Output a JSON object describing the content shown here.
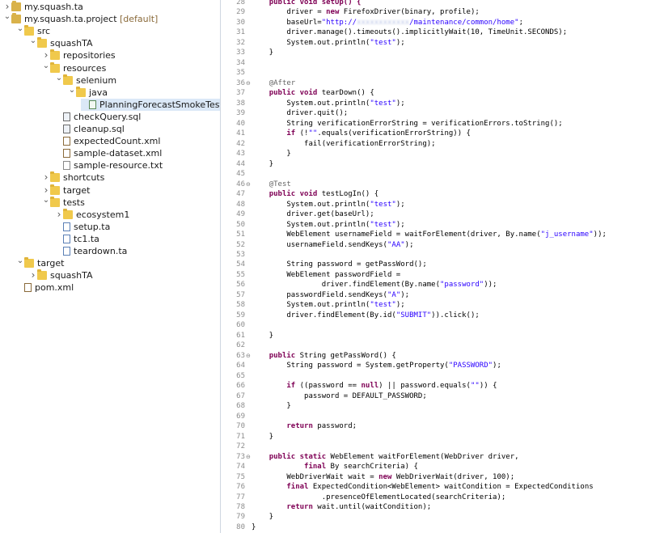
{
  "tree": [
    {
      "label": "my.squash.ta",
      "icon": "project-icon",
      "depth": 0,
      "toggle": "closed"
    },
    {
      "label": "my.squash.ta.project",
      "decoration": " [default]",
      "icon": "project-icon",
      "depth": 0,
      "toggle": "open"
    },
    {
      "label": "src",
      "icon": "folder-icon",
      "depth": 1,
      "toggle": "open"
    },
    {
      "label": "squashTA",
      "icon": "folder-icon",
      "depth": 2,
      "toggle": "open"
    },
    {
      "label": "repositories",
      "icon": "folder-icon",
      "depth": 3,
      "toggle": "closed"
    },
    {
      "label": "resources",
      "icon": "folder-icon",
      "depth": 3,
      "toggle": "open"
    },
    {
      "label": "selenium",
      "icon": "folder-icon",
      "depth": 4,
      "toggle": "open"
    },
    {
      "label": "java",
      "icon": "folder-icon",
      "depth": 5,
      "toggle": "open"
    },
    {
      "label": "PlanningForecastSmokeTest.jav",
      "icon": "java-file-icon",
      "depth": 6,
      "toggle": "",
      "selected": true
    },
    {
      "label": "checkQuery.sql",
      "icon": "sql-file-icon",
      "depth": 4,
      "toggle": ""
    },
    {
      "label": "cleanup.sql",
      "icon": "sql-file-icon",
      "depth": 4,
      "toggle": ""
    },
    {
      "label": "expectedCount.xml",
      "icon": "xml-file-icon",
      "depth": 4,
      "toggle": ""
    },
    {
      "label": "sample-dataset.xml",
      "icon": "xml-file-icon",
      "depth": 4,
      "toggle": ""
    },
    {
      "label": "sample-resource.txt",
      "icon": "txt-file-icon",
      "depth": 4,
      "toggle": ""
    },
    {
      "label": "shortcuts",
      "icon": "folder-icon",
      "depth": 3,
      "toggle": "closed"
    },
    {
      "label": "target",
      "icon": "folder-icon",
      "depth": 3,
      "toggle": "closed"
    },
    {
      "label": "tests",
      "icon": "folder-icon",
      "depth": 3,
      "toggle": "open"
    },
    {
      "label": "ecosystem1",
      "icon": "folder-icon",
      "depth": 4,
      "toggle": "closed"
    },
    {
      "label": "setup.ta",
      "icon": "ta-file-icon",
      "depth": 4,
      "toggle": ""
    },
    {
      "label": "tc1.ta",
      "icon": "ta-file-icon",
      "depth": 4,
      "toggle": ""
    },
    {
      "label": "teardown.ta",
      "icon": "ta-file-icon",
      "depth": 4,
      "toggle": ""
    },
    {
      "label": "target",
      "icon": "folder-icon",
      "depth": 1,
      "toggle": "open"
    },
    {
      "label": "squashTA",
      "icon": "folder-icon",
      "depth": 2,
      "toggle": "closed"
    },
    {
      "label": "pom.xml",
      "icon": "xml-file-icon",
      "depth": 1,
      "toggle": ""
    }
  ],
  "editor": {
    "lines": [
      {
        "n": "28",
        "segs": [
          [
            "    ",
            ""
          ],
          [
            "public void setUp() {",
            "kw-partial"
          ]
        ]
      },
      {
        "n": "29",
        "segs": [
          [
            "        driver = ",
            ""
          ],
          [
            "new",
            "kw"
          ],
          [
            " FirefoxDriver(binary, profile);",
            ""
          ]
        ]
      },
      {
        "n": "30",
        "segs": [
          [
            "        baseUrl=",
            ""
          ],
          [
            "\"http://",
            "str"
          ],
          [
            "xxxxxxxxxxxx",
            "blur"
          ],
          [
            "/maintenance/common/home\"",
            "str"
          ],
          [
            ";",
            ""
          ]
        ]
      },
      {
        "n": "31",
        "segs": [
          [
            "        driver.manage().timeouts().implicitlyWait(10, TimeUnit.SECONDS);",
            ""
          ]
        ]
      },
      {
        "n": "32",
        "segs": [
          [
            "        System.out.println(",
            ""
          ],
          [
            "\"test\"",
            "str"
          ],
          [
            ");",
            ""
          ]
        ]
      },
      {
        "n": "33",
        "segs": [
          [
            "    }",
            ""
          ]
        ]
      },
      {
        "n": "34",
        "segs": []
      },
      {
        "n": "35",
        "segs": []
      },
      {
        "n": "36",
        "fold": true,
        "segs": [
          [
            "    ",
            ""
          ],
          [
            "@After",
            "ann"
          ]
        ]
      },
      {
        "n": "37",
        "segs": [
          [
            "    ",
            ""
          ],
          [
            "public",
            "kw"
          ],
          [
            " ",
            ""
          ],
          [
            "void",
            "kw"
          ],
          [
            " tearDown() {",
            ""
          ]
        ]
      },
      {
        "n": "38",
        "segs": [
          [
            "        System.out.println(",
            ""
          ],
          [
            "\"test\"",
            "str"
          ],
          [
            ");",
            ""
          ]
        ]
      },
      {
        "n": "39",
        "segs": [
          [
            "        driver.quit();",
            ""
          ]
        ]
      },
      {
        "n": "40",
        "segs": [
          [
            "        String verificationErrorString = verificationErrors.toString();",
            ""
          ]
        ]
      },
      {
        "n": "41",
        "segs": [
          [
            "        ",
            ""
          ],
          [
            "if",
            "kw"
          ],
          [
            " (!",
            ""
          ],
          [
            "\"\"",
            "str"
          ],
          [
            ".equals(verificationErrorString)) {",
            ""
          ]
        ]
      },
      {
        "n": "42",
        "segs": [
          [
            "            fail(verificationErrorString);",
            ""
          ]
        ]
      },
      {
        "n": "43",
        "segs": [
          [
            "        }",
            ""
          ]
        ]
      },
      {
        "n": "44",
        "segs": [
          [
            "    }",
            ""
          ]
        ]
      },
      {
        "n": "45",
        "segs": []
      },
      {
        "n": "46",
        "fold": true,
        "segs": [
          [
            "    ",
            ""
          ],
          [
            "@Test",
            "ann"
          ]
        ]
      },
      {
        "n": "47",
        "segs": [
          [
            "    ",
            ""
          ],
          [
            "public",
            "kw"
          ],
          [
            " ",
            ""
          ],
          [
            "void",
            "kw"
          ],
          [
            " testLogIn() {",
            ""
          ]
        ]
      },
      {
        "n": "48",
        "segs": [
          [
            "        System.out.println(",
            ""
          ],
          [
            "\"test\"",
            "str"
          ],
          [
            ");",
            ""
          ]
        ]
      },
      {
        "n": "49",
        "segs": [
          [
            "        driver.get(baseUrl);",
            ""
          ]
        ]
      },
      {
        "n": "50",
        "segs": [
          [
            "        System.out.println(",
            ""
          ],
          [
            "\"test\"",
            "str"
          ],
          [
            ");",
            ""
          ]
        ]
      },
      {
        "n": "51",
        "segs": [
          [
            "        WebElement usernameField = waitForElement(driver, By.name(",
            ""
          ],
          [
            "\"j_username\"",
            "str"
          ],
          [
            "));",
            ""
          ]
        ]
      },
      {
        "n": "52",
        "segs": [
          [
            "        usernameField.sendKeys(",
            ""
          ],
          [
            "\"AA\"",
            "str"
          ],
          [
            ");",
            ""
          ]
        ]
      },
      {
        "n": "53",
        "segs": []
      },
      {
        "n": "54",
        "segs": [
          [
            "        String password = getPassWord();",
            ""
          ]
        ]
      },
      {
        "n": "55",
        "segs": [
          [
            "        WebElement passwordField =",
            ""
          ]
        ]
      },
      {
        "n": "56",
        "segs": [
          [
            "                driver.findElement(By.name(",
            ""
          ],
          [
            "\"password\"",
            "str"
          ],
          [
            "));",
            ""
          ]
        ]
      },
      {
        "n": "57",
        "segs": [
          [
            "        passwordField.sendKeys(",
            ""
          ],
          [
            "\"A\"",
            "str"
          ],
          [
            ");",
            ""
          ]
        ]
      },
      {
        "n": "58",
        "segs": [
          [
            "        System.out.println(",
            ""
          ],
          [
            "\"test\"",
            "str"
          ],
          [
            ");",
            ""
          ]
        ]
      },
      {
        "n": "59",
        "segs": [
          [
            "        driver.findElement(By.id(",
            ""
          ],
          [
            "\"SUBMIT\"",
            "str"
          ],
          [
            ")).click();",
            ""
          ]
        ]
      },
      {
        "n": "60",
        "segs": []
      },
      {
        "n": "61",
        "segs": [
          [
            "    }",
            ""
          ]
        ]
      },
      {
        "n": "62",
        "segs": []
      },
      {
        "n": "63",
        "fold": true,
        "segs": [
          [
            "    ",
            ""
          ],
          [
            "public",
            "kw"
          ],
          [
            " String getPassWord() {",
            ""
          ]
        ]
      },
      {
        "n": "64",
        "segs": [
          [
            "        String password = System.getProperty(",
            ""
          ],
          [
            "\"PASSWORD\"",
            "str"
          ],
          [
            ");",
            ""
          ]
        ]
      },
      {
        "n": "65",
        "segs": []
      },
      {
        "n": "66",
        "segs": [
          [
            "        ",
            ""
          ],
          [
            "if",
            "kw"
          ],
          [
            " ((password == ",
            ""
          ],
          [
            "null",
            "kw"
          ],
          [
            ") || password.equals(",
            ""
          ],
          [
            "\"\"",
            "str"
          ],
          [
            ")) {",
            ""
          ]
        ]
      },
      {
        "n": "67",
        "segs": [
          [
            "            password = DEFAULT_PASSWORD;",
            ""
          ]
        ]
      },
      {
        "n": "68",
        "segs": [
          [
            "        }",
            ""
          ]
        ]
      },
      {
        "n": "69",
        "segs": []
      },
      {
        "n": "70",
        "segs": [
          [
            "        ",
            ""
          ],
          [
            "return",
            "kw"
          ],
          [
            " password;",
            ""
          ]
        ]
      },
      {
        "n": "71",
        "segs": [
          [
            "    }",
            ""
          ]
        ]
      },
      {
        "n": "72",
        "segs": []
      },
      {
        "n": "73",
        "fold": true,
        "segs": [
          [
            "    ",
            ""
          ],
          [
            "public",
            "kw"
          ],
          [
            " ",
            ""
          ],
          [
            "static",
            "kw"
          ],
          [
            " WebElement waitForElement(WebDriver driver,",
            ""
          ]
        ]
      },
      {
        "n": "74",
        "segs": [
          [
            "            ",
            ""
          ],
          [
            "final",
            "kw"
          ],
          [
            " By searchCriteria) {",
            ""
          ]
        ]
      },
      {
        "n": "75",
        "segs": [
          [
            "        WebDriverWait wait = ",
            ""
          ],
          [
            "new",
            "kw"
          ],
          [
            " WebDriverWait(driver, 100);",
            ""
          ]
        ]
      },
      {
        "n": "76",
        "segs": [
          [
            "        ",
            ""
          ],
          [
            "final",
            "kw"
          ],
          [
            " ExpectedCondition<WebElement> waitCondition = ExpectedConditions",
            ""
          ]
        ]
      },
      {
        "n": "77",
        "segs": [
          [
            "                .presenceOfElementLocated(searchCriteria);",
            ""
          ]
        ]
      },
      {
        "n": "78",
        "segs": [
          [
            "        ",
            ""
          ],
          [
            "return",
            "kw"
          ],
          [
            " wait.until(waitCondition);",
            ""
          ]
        ]
      },
      {
        "n": "79",
        "segs": [
          [
            "    }",
            ""
          ]
        ]
      },
      {
        "n": "80",
        "segs": [
          [
            "}",
            ""
          ]
        ]
      }
    ]
  }
}
